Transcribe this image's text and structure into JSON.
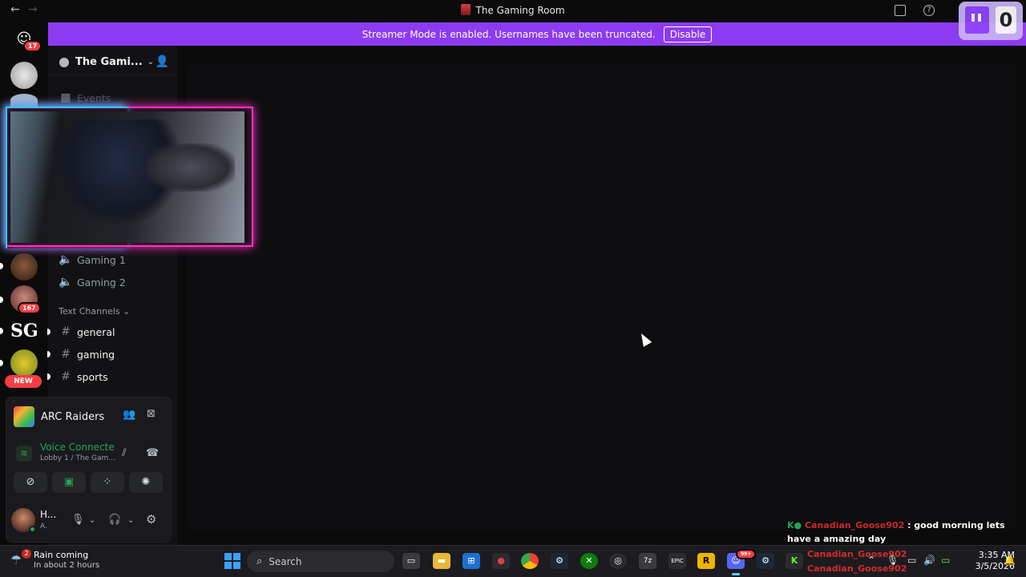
{
  "window": {
    "title": "The Gaming Room",
    "back_icon": "arrow-left-icon",
    "forward_icon": "arrow-right-icon"
  },
  "overlay": {
    "twitch_count": "0"
  },
  "banner": {
    "text": "Streamer Mode is enabled. Usernames have been truncated.",
    "button_label": "Disable"
  },
  "rail": {
    "home_badge": "17",
    "dm_badge": "167",
    "sg_label": "SG",
    "new_label": "NEW"
  },
  "server": {
    "name": "The Gami...",
    "events_label": "Events",
    "voice_channels": [
      "Gaming 1",
      "Gaming 2"
    ],
    "category_label": "Text Channels",
    "text_channels": [
      "general",
      "gaming",
      "sports"
    ]
  },
  "voice": {
    "activity_name": "ARC Raiders",
    "status": "Voice Connecte",
    "location": "Lobby 1 / The Gam..."
  },
  "user": {
    "name": "H...",
    "status": "A."
  },
  "chat": {
    "message_user": "Canadian_Goose902",
    "message_text": ": good morning lets have a amazing day",
    "line2_user": "Canadian_Goose902",
    "line3_user": "Canadian_Goose902"
  },
  "taskbar": {
    "weather_badge": "2",
    "weather_title": "Rain coming",
    "weather_subtitle": "In about 2 hours",
    "search_placeholder": "Search",
    "time": "3:35 AM",
    "date": "3/5/2026",
    "discord_badge": "99+"
  },
  "colors": {
    "streamer_banner": "#8d3bf2",
    "voice_connected": "#23a55a",
    "webcam_frame_pink": "#ff2fc8",
    "webcam_frame_blue": "#2ec8ff",
    "chat_username": "#d42a2a"
  }
}
